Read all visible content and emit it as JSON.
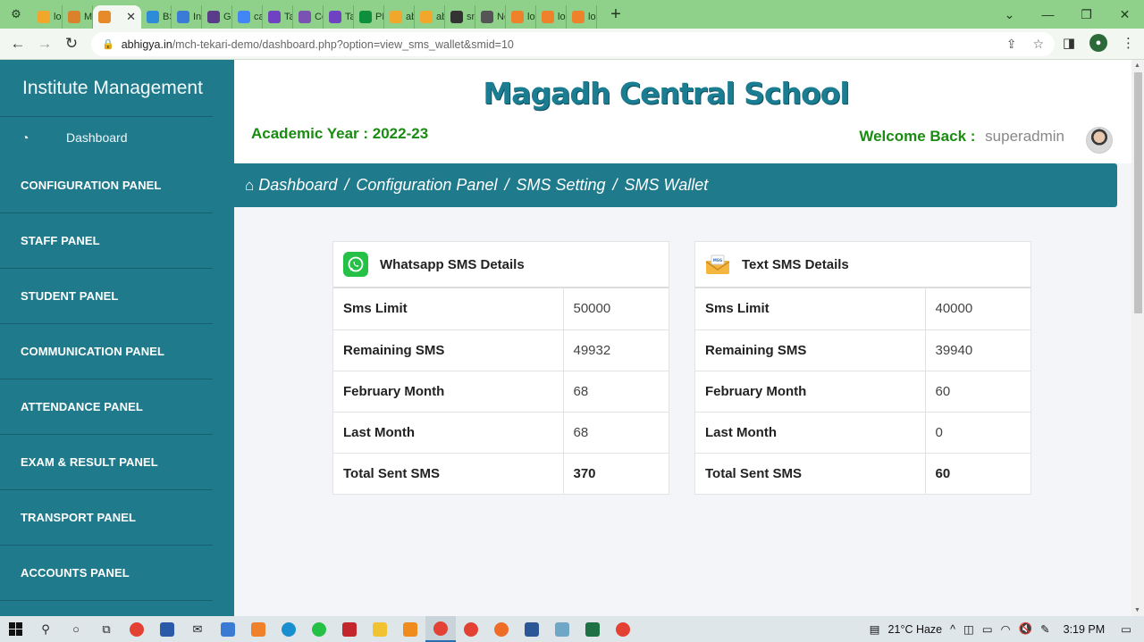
{
  "browser": {
    "tabs": [
      {
        "label": "loc",
        "color": "#f1a72b"
      },
      {
        "label": "Ma",
        "color": "#d9822b"
      },
      {
        "label": "",
        "color": "#e58b2b",
        "active": true
      },
      {
        "label": "BS",
        "color": "#2d8bd8"
      },
      {
        "label": "Inf",
        "color": "#3a7bd5"
      },
      {
        "label": "GD",
        "color": "#5a3d8a"
      },
      {
        "label": "cal",
        "color": "#4285f4"
      },
      {
        "label": "Tal",
        "color": "#6f42c1"
      },
      {
        "label": "Co",
        "color": "#7952b3"
      },
      {
        "label": "Tal",
        "color": "#6f42c1"
      },
      {
        "label": "PH",
        "color": "#0d8f3b"
      },
      {
        "label": "ab",
        "color": "#f1a72b"
      },
      {
        "label": "ab",
        "color": "#f1a72b"
      },
      {
        "label": "sm",
        "color": "#333333"
      },
      {
        "label": "Ne",
        "color": "#555555"
      },
      {
        "label": "loc",
        "color": "#f0812b"
      },
      {
        "label": "loc",
        "color": "#f0812b"
      },
      {
        "label": "loc",
        "color": "#f0812b"
      }
    ],
    "url_host": "abhigya.in",
    "url_path": "/mch-tekari-demo/dashboard.php?option=view_sms_wallet&smid=10"
  },
  "sidebar": {
    "brand": "Institute Management",
    "dashboard": "Dashboard",
    "items": [
      "CONFIGURATION PANEL",
      "STAFF PANEL",
      "STUDENT PANEL",
      "COMMUNICATION PANEL",
      "ATTENDANCE PANEL",
      "EXAM & RESULT PANEL",
      "TRANSPORT PANEL",
      "ACCOUNTS PANEL"
    ]
  },
  "header": {
    "school_name": "Magadh Central School",
    "academic_year": "Academic Year : 2022-23",
    "welcome_label": "Welcome Back :",
    "username": "superadmin"
  },
  "breadcrumb": [
    "Dashboard",
    "Configuration Panel",
    "SMS Setting",
    "SMS Wallet"
  ],
  "whatsapp_card": {
    "title": "Whatsapp SMS Details",
    "rows": [
      {
        "label": "Sms Limit",
        "value": "50000"
      },
      {
        "label": "Remaining SMS",
        "value": "49932"
      },
      {
        "label": "February Month",
        "value": "68"
      },
      {
        "label": "Last Month",
        "value": "68"
      },
      {
        "label": "Total Sent SMS",
        "value": "370"
      }
    ]
  },
  "text_card": {
    "title": "Text SMS Details",
    "rows": [
      {
        "label": "Sms Limit",
        "value": "40000"
      },
      {
        "label": "Remaining SMS",
        "value": "39940"
      },
      {
        "label": "February Month",
        "value": "60"
      },
      {
        "label": "Last Month",
        "value": "0"
      },
      {
        "label": "Total Sent SMS",
        "value": "60"
      }
    ]
  },
  "taskbar": {
    "weather": "21°C  Haze",
    "time": "3:19 PM"
  }
}
